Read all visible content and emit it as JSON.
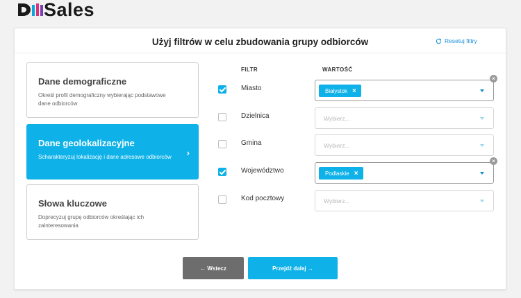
{
  "logo": {
    "text": "Sales"
  },
  "title": "Użyj filtrów w celu zbudowania grupy odbiorców",
  "reset_label": "Resetuj filtry",
  "categories": [
    {
      "title": "Dane demograficzne",
      "desc": "Określ profil demograficzny wybierając podstawowe dane odbiorców"
    },
    {
      "title": "Dane geolokalizacyjne",
      "desc": "Scharakteryzuj lokalizację i dane adresowe odbiorców",
      "active": true
    },
    {
      "title": "Słowa kluczowe",
      "desc": "Doprecyzuj grupę odbiorców określając ich zainteresowania"
    }
  ],
  "columns": {
    "filter": "FILTR",
    "value": "WARTOŚĆ"
  },
  "filters": [
    {
      "label": "Miasto",
      "checked": true,
      "tag": "Białystok",
      "placeholder": ""
    },
    {
      "label": "Dzielnica",
      "checked": false,
      "tag": "",
      "placeholder": "Wybierz..."
    },
    {
      "label": "Gmina",
      "checked": false,
      "tag": "",
      "placeholder": "Wybierz..."
    },
    {
      "label": "Województwo",
      "checked": true,
      "tag": "Podlaskie",
      "placeholder": ""
    },
    {
      "label": "Kod pocztowy",
      "checked": false,
      "tag": "",
      "placeholder": "Wybierz..."
    }
  ],
  "buttons": {
    "back": "← Wstecz",
    "next": "Przejdź dalej →"
  },
  "colors": {
    "accent": "#0eb1e8",
    "back_button": "#6d6d6d",
    "logo_blue": "#0ea5de",
    "logo_pink": "#d8327a"
  }
}
